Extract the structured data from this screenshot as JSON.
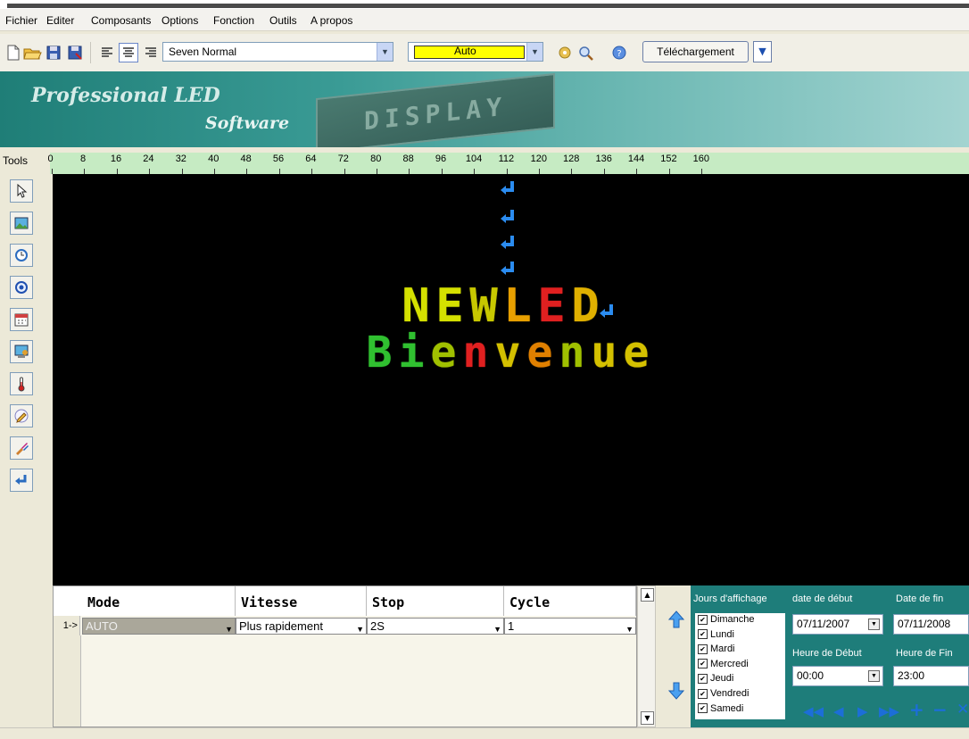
{
  "menu": [
    "Fichier",
    "Editer",
    "Composants",
    "Options",
    "Fonction",
    "Outils",
    "A propos"
  ],
  "toolbar": {
    "font_select": "Seven Normal",
    "color_select": "Auto",
    "download_label": "Téléchargement"
  },
  "banner": {
    "line1": "Professional LED",
    "line2": "Software",
    "sign_text": "DISPLAY"
  },
  "ruler": {
    "label": "Tools",
    "ticks": [
      "0",
      "8",
      "16",
      "24",
      "32",
      "40",
      "48",
      "56",
      "64",
      "72",
      "80",
      "88",
      "96",
      "104",
      "112",
      "120",
      "128",
      "136",
      "144",
      "152",
      "160"
    ]
  },
  "tools": [
    "pointer-icon",
    "picture-icon",
    "clock-icon",
    "temperature-circle-icon",
    "calendar-icon",
    "counter-icon",
    "thermometer-icon",
    "pencil-icon",
    "brush-icon",
    "return-icon"
  ],
  "display": {
    "line1": [
      "N",
      "E",
      "W",
      "L",
      "E",
      "D"
    ],
    "line1_colors": [
      "#d4e000",
      "#d4e000",
      "#c8c800",
      "#e8a000",
      "#e02020",
      "#e0b000"
    ],
    "line2": [
      "B",
      "i",
      "e",
      "n",
      "v",
      "e",
      "n",
      "u",
      "e"
    ],
    "line2_colors": [
      "#30c030",
      "#30c030",
      "#a0c000",
      "#e02020",
      "#d4c000",
      "#e08000",
      "#a0c000",
      "#d4c000",
      "#d4c000"
    ]
  },
  "grid": {
    "headers": [
      "Mode",
      "Vitesse",
      "Stop",
      "Cycle"
    ],
    "row_label": "1->",
    "row": {
      "mode": "AUTO",
      "vitesse": "Plus rapidement",
      "stop": "2S",
      "cycle": "1"
    }
  },
  "schedule": {
    "days_label": "Jours d'affichage",
    "start_date_label": "date de début",
    "end_date_label": "Date de fin",
    "days": [
      "Dimanche",
      "Lundi",
      "Mardi",
      "Mercredi",
      "Jeudi",
      "Vendredi",
      "Samedi"
    ],
    "start_date": "07/11/2007",
    "end_date": "07/11/2008",
    "start_time_label": "Heure de Début",
    "end_time_label": "Heure de Fin",
    "start_time": "00:00",
    "end_time": "23:00"
  }
}
